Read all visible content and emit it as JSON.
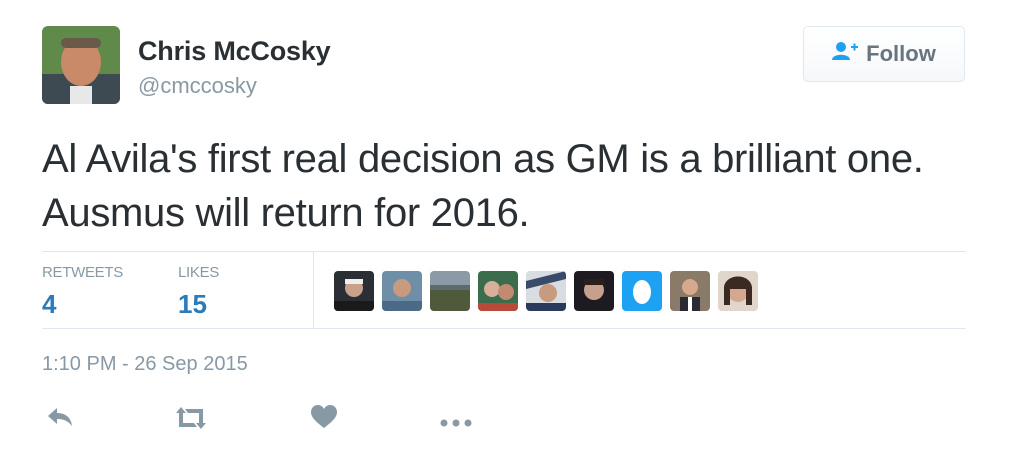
{
  "author": {
    "name": "Chris McCosky",
    "handle": "@cmccosky"
  },
  "follow_button": {
    "label": "Follow",
    "icon": "add-user-icon"
  },
  "tweet": {
    "text": "Al Avila's first real decision as GM is a brilliant one. Ausmus will return for 2016."
  },
  "stats": {
    "retweets_label": "RETWEETS",
    "retweets_count": "4",
    "likes_label": "LIKES",
    "likes_count": "15"
  },
  "timestamp": "1:10 PM - 26 Sep 2015",
  "actions": [
    "reply-icon",
    "retweet-icon",
    "like-icon",
    "more-icon"
  ],
  "colors": {
    "text": "#292f33",
    "muted": "#8899a6",
    "link_blue": "#2b7bb9",
    "icon_blue": "#1da1f2",
    "divider": "#e1e8ed"
  }
}
